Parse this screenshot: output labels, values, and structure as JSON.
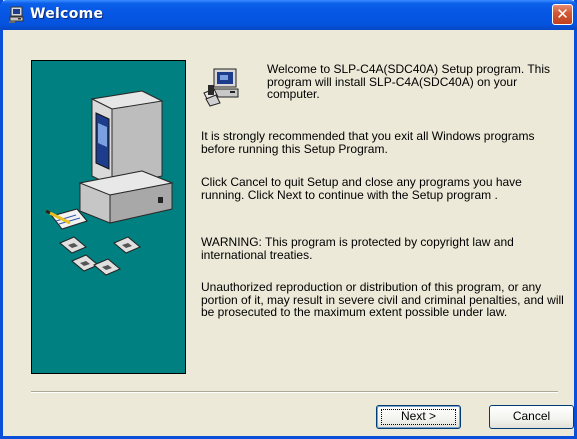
{
  "window": {
    "title": "Welcome",
    "close_glyph": "✕"
  },
  "icons": {
    "title": "setup-computer-icon",
    "illustration": "computer-and-disks-illustration",
    "setup": "setup-install-icon"
  },
  "content": {
    "welcome": "Welcome to SLP-C4A(SDC40A) Setup program. This program will install SLP-C4A(SDC40A) on your computer.",
    "paragraph1": "It is strongly recommended that you exit all Windows programs before running this Setup Program.",
    "paragraph2": "Click Cancel to quit Setup and close any programs you have running.  Click Next to continue with the Setup program .",
    "paragraph3": "WARNING: This program is protected by copyright law and international treaties.",
    "paragraph4": "Unauthorized reproduction or distribution of this program, or any portion of it, may result in severe civil and criminal penalties, and will be prosecuted to the maximum extent possible under law."
  },
  "buttons": {
    "next": "Next >",
    "cancel": "Cancel"
  },
  "colors": {
    "title_bar": "#0656E4",
    "panel": "#008080",
    "background": "#ECE9D8",
    "close": "#C0401E"
  }
}
